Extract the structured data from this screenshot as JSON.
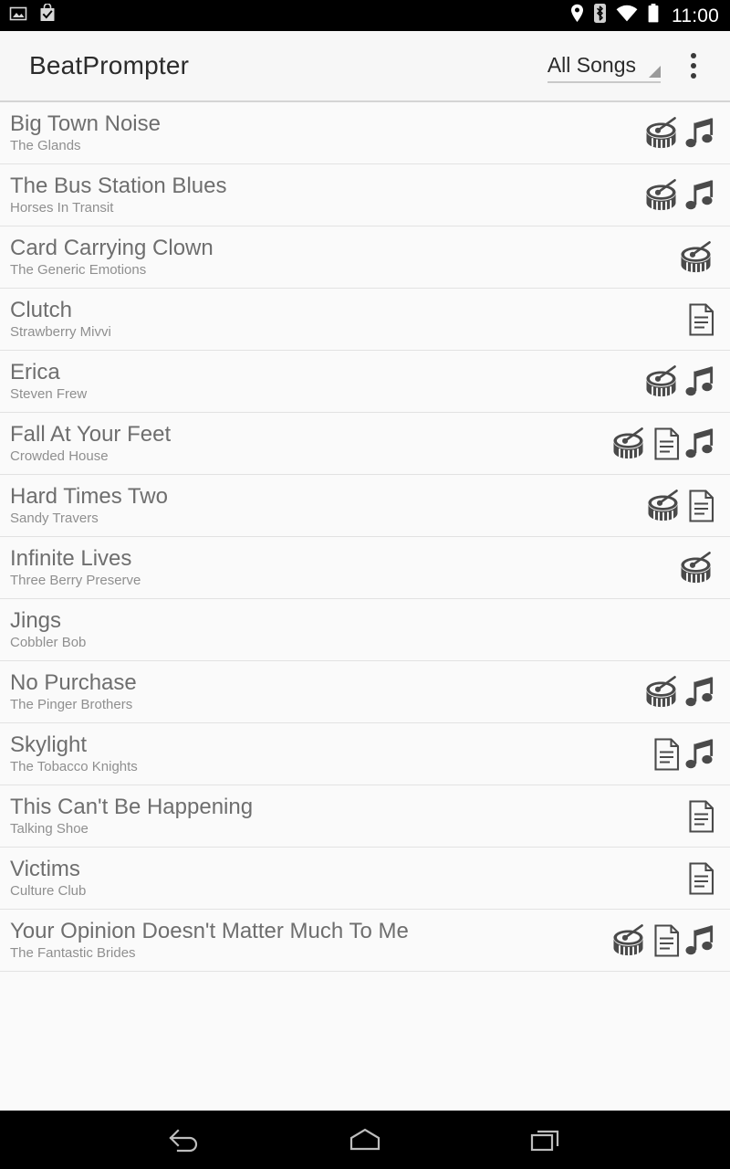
{
  "status_bar": {
    "left_icons": [
      "screenshot-image-icon",
      "app-install-bag-icon"
    ],
    "right_icons": [
      "location-pin-icon",
      "bluetooth-icon",
      "wifi-icon",
      "battery-icon"
    ],
    "clock": "11:00",
    "background_color": "#000000",
    "foreground_color": "#ffffff"
  },
  "action_bar": {
    "title": "BeatPrompter",
    "spinner_label": "All Songs",
    "spinner_icon": "dropdown-triangle-icon",
    "overflow_icon": "overflow-menu-icon",
    "background_color": "#f7f7f7",
    "title_color": "#2b2b2b"
  },
  "list": {
    "title_color": "#6e6e6e",
    "artist_color": "#8f8f8f",
    "divider_color": "#e2e2e2",
    "background_color": "#fafafa",
    "icon_color": "#4a4a4a",
    "songs": [
      {
        "title": "Big Town Noise",
        "artist": "The Glands",
        "icons": [
          "drum-icon",
          "music-note-icon"
        ]
      },
      {
        "title": "The Bus Station Blues",
        "artist": "Horses In Transit",
        "icons": [
          "drum-icon",
          "music-note-icon"
        ]
      },
      {
        "title": "Card Carrying Clown",
        "artist": "The Generic Emotions",
        "icons": [
          "drum-icon"
        ]
      },
      {
        "title": "Clutch",
        "artist": "Strawberry Mivvi",
        "icons": [
          "document-icon"
        ]
      },
      {
        "title": "Erica",
        "artist": "Steven Frew",
        "icons": [
          "drum-icon",
          "music-note-icon"
        ]
      },
      {
        "title": "Fall At Your Feet",
        "artist": "Crowded House",
        "icons": [
          "drum-icon",
          "document-icon",
          "music-note-icon"
        ]
      },
      {
        "title": "Hard Times Two",
        "artist": "Sandy Travers",
        "icons": [
          "drum-icon",
          "document-icon"
        ]
      },
      {
        "title": "Infinite Lives",
        "artist": "Three Berry Preserve",
        "icons": [
          "drum-icon"
        ]
      },
      {
        "title": "Jings",
        "artist": "Cobbler Bob",
        "icons": []
      },
      {
        "title": "No Purchase",
        "artist": "The Pinger Brothers",
        "icons": [
          "drum-icon",
          "music-note-icon"
        ]
      },
      {
        "title": "Skylight",
        "artist": "The Tobacco Knights",
        "icons": [
          "document-icon",
          "music-note-icon"
        ]
      },
      {
        "title": "This Can't Be Happening",
        "artist": "Talking Shoe",
        "icons": [
          "document-icon"
        ]
      },
      {
        "title": "Victims",
        "artist": "Culture Club",
        "icons": [
          "document-icon"
        ]
      },
      {
        "title": "Your Opinion Doesn't Matter Much To Me",
        "artist": "The Fantastic Brides",
        "icons": [
          "drum-icon",
          "document-icon",
          "music-note-icon"
        ]
      }
    ]
  },
  "nav_bar": {
    "buttons": [
      "back-nav-icon",
      "home-nav-icon",
      "recents-nav-icon"
    ],
    "background_color": "#000000",
    "icon_color": "#bdbdbd"
  }
}
